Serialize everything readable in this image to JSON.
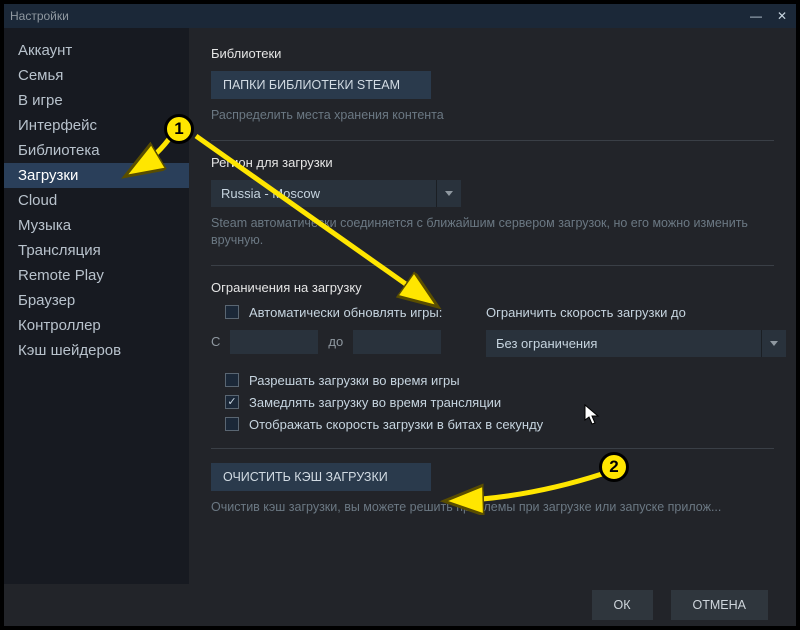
{
  "window": {
    "title": "Настройки"
  },
  "sidebar": {
    "items": [
      {
        "label": "Аккаунт"
      },
      {
        "label": "Семья"
      },
      {
        "label": "В игре"
      },
      {
        "label": "Интерфейс"
      },
      {
        "label": "Библиотека"
      },
      {
        "label": "Загрузки"
      },
      {
        "label": "Cloud"
      },
      {
        "label": "Музыка"
      },
      {
        "label": "Трансляция"
      },
      {
        "label": "Remote Play"
      },
      {
        "label": "Браузер"
      },
      {
        "label": "Контроллер"
      },
      {
        "label": "Кэш шейдеров"
      }
    ],
    "active_index": 5
  },
  "sections": {
    "libraries": {
      "title": "Библиотеки",
      "button": "ПАПКИ БИБЛИОТЕКИ STEAM",
      "helper": "Распределить места хранения контента"
    },
    "region": {
      "title": "Регион для загрузки",
      "selected": "Russia - Moscow",
      "helper": "Steam автоматически соединяется с ближайшим сервером загрузок, но его можно изменить вручную."
    },
    "restrictions": {
      "title": "Ограничения на загрузку",
      "auto_update_label": "Автоматически обновлять игры:",
      "from_label": "С",
      "to_label": "до",
      "limit_label": "Ограничить скорость загрузки до",
      "limit_selected": "Без ограничения",
      "allow_during_gameplay": "Разрешать загрузки во время игры",
      "throttle_during_stream": "Замедлять загрузку во время трансляции",
      "show_bits": "Отображать скорость загрузки в битах в секунду"
    },
    "cache": {
      "button": "ОЧИСТИТЬ КЭШ ЗАГРУЗКИ",
      "helper": "Очистив кэш загрузки, вы можете решить проблемы при загрузке или запуске прилож..."
    }
  },
  "footer": {
    "ok": "ОК",
    "cancel": "ОТМЕНА"
  },
  "annotations": {
    "badge1": "1",
    "badge2": "2"
  }
}
